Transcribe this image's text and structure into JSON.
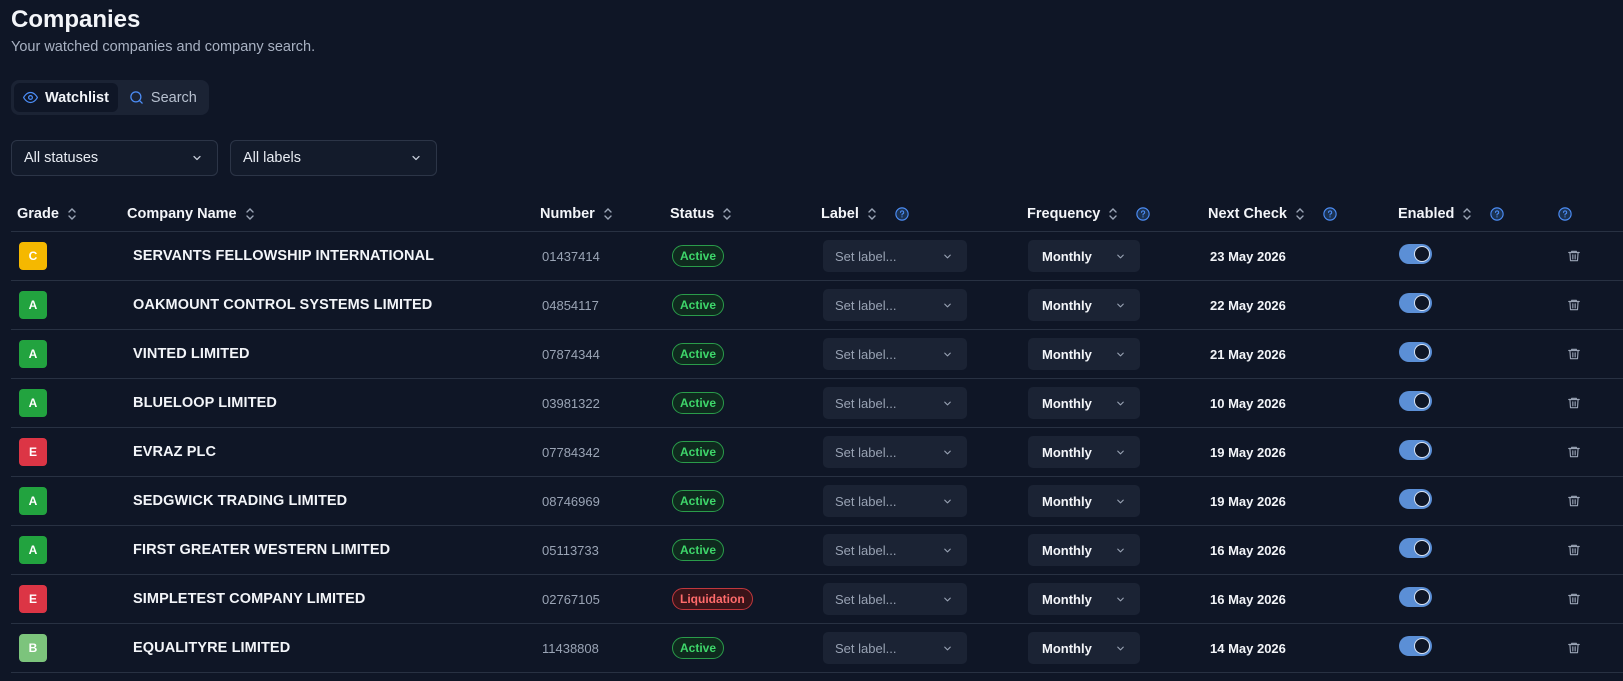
{
  "header": {
    "title": "Companies",
    "subtitle": "Your watched companies and company search."
  },
  "tabs": [
    {
      "label": "Watchlist",
      "icon": "eye-icon",
      "active": true
    },
    {
      "label": "Search",
      "icon": "search-icon",
      "active": false
    }
  ],
  "filters": {
    "status": "All statuses",
    "labels": "All labels"
  },
  "table": {
    "columns": {
      "grade": "Grade",
      "company_name": "Company Name",
      "number": "Number",
      "status": "Status",
      "label": "Label",
      "frequency": "Frequency",
      "next_check": "Next Check",
      "enabled": "Enabled"
    },
    "rows": [
      {
        "grade": "C",
        "grade_color": "#f5b800",
        "name": "SERVANTS FELLOWSHIP INTERNATIONAL",
        "number": "01437414",
        "status": "Active",
        "status_type": "active",
        "label": "Set label...",
        "frequency": "Monthly",
        "next_check": "23 May 2026",
        "enabled": true
      },
      {
        "grade": "A",
        "grade_color": "#22a33f",
        "name": "OAKMOUNT CONTROL SYSTEMS LIMITED",
        "number": "04854117",
        "status": "Active",
        "status_type": "active",
        "label": "Set label...",
        "frequency": "Monthly",
        "next_check": "22 May 2026",
        "enabled": true
      },
      {
        "grade": "A",
        "grade_color": "#22a33f",
        "name": "VINTED LIMITED",
        "number": "07874344",
        "status": "Active",
        "status_type": "active",
        "label": "Set label...",
        "frequency": "Monthly",
        "next_check": "21 May 2026",
        "enabled": true
      },
      {
        "grade": "A",
        "grade_color": "#22a33f",
        "name": "BLUELOOP LIMITED",
        "number": "03981322",
        "status": "Active",
        "status_type": "active",
        "label": "Set label...",
        "frequency": "Monthly",
        "next_check": "10 May 2026",
        "enabled": true
      },
      {
        "grade": "E",
        "grade_color": "#dc3545",
        "name": "EVRAZ PLC",
        "number": "07784342",
        "status": "Active",
        "status_type": "active",
        "label": "Set label...",
        "frequency": "Monthly",
        "next_check": "19 May 2026",
        "enabled": true
      },
      {
        "grade": "A",
        "grade_color": "#22a33f",
        "name": "SEDGWICK TRADING LIMITED",
        "number": "08746969",
        "status": "Active",
        "status_type": "active",
        "label": "Set label...",
        "frequency": "Monthly",
        "next_check": "19 May 2026",
        "enabled": true
      },
      {
        "grade": "A",
        "grade_color": "#22a33f",
        "name": "FIRST GREATER WESTERN LIMITED",
        "number": "05113733",
        "status": "Active",
        "status_type": "active",
        "label": "Set label...",
        "frequency": "Monthly",
        "next_check": "16 May 2026",
        "enabled": true
      },
      {
        "grade": "E",
        "grade_color": "#dc3545",
        "name": "SIMPLETEST COMPANY LIMITED",
        "number": "02767105",
        "status": "Liquidation",
        "status_type": "liquidation",
        "label": "Set label...",
        "frequency": "Monthly",
        "next_check": "16 May 2026",
        "enabled": true
      },
      {
        "grade": "B",
        "grade_color": "#7cc47c",
        "name": "EQUALITYRE LIMITED",
        "number": "11438808",
        "status": "Active",
        "status_type": "active",
        "label": "Set label...",
        "frequency": "Monthly",
        "next_check": "14 May 2026",
        "enabled": true
      }
    ]
  },
  "colors": {
    "background": "#0f1626",
    "accent": "#5b8fd6",
    "active_status": "#3ed66a",
    "liquidation_status": "#ff6b6b"
  }
}
